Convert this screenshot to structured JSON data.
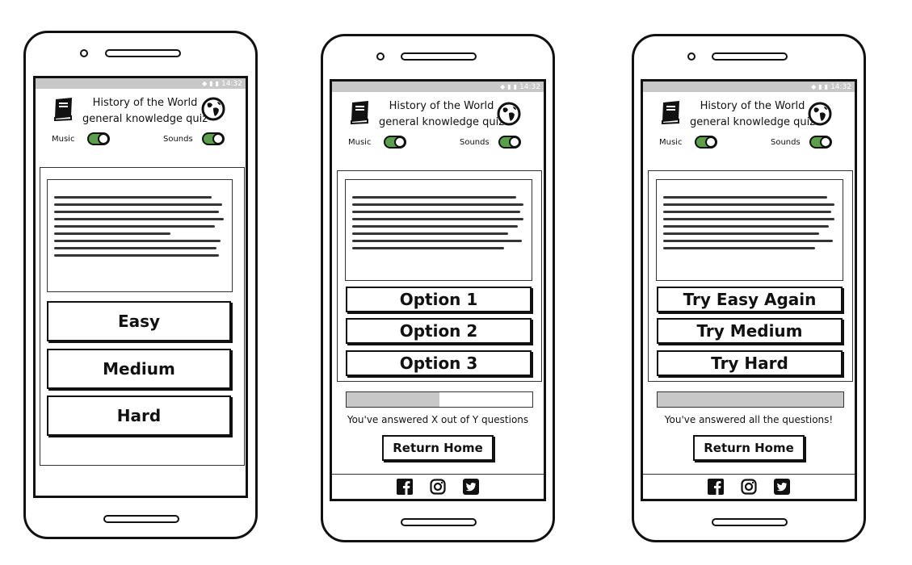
{
  "app": {
    "title": "History of the World",
    "subtitle": "general knowledge quiz",
    "status_time": "14:32",
    "music_label": "Music",
    "sounds_label": "Sounds"
  },
  "screens": [
    {
      "name": "difficulty-select",
      "buttons": [
        "Easy",
        "Medium",
        "Hard"
      ]
    },
    {
      "name": "question",
      "options": [
        "Option 1",
        "Option 2",
        "Option 3"
      ],
      "progress_fraction": 0.5,
      "answered_text": "You've answered X out of Y questions",
      "return_home": "Return Home",
      "social": [
        "facebook-icon",
        "instagram-icon",
        "twitter-icon"
      ]
    },
    {
      "name": "results",
      "options": [
        "Try Easy Again",
        "Try Medium",
        "Try Hard"
      ],
      "progress_fraction": 1.0,
      "answered_text": "You've answered all the questions!",
      "return_home": "Return Home",
      "social": [
        "facebook-icon",
        "instagram-icon",
        "twitter-icon"
      ]
    }
  ],
  "colors": {
    "toggle_on": "#5aa04a",
    "status_bar": "#c8c8c8"
  }
}
